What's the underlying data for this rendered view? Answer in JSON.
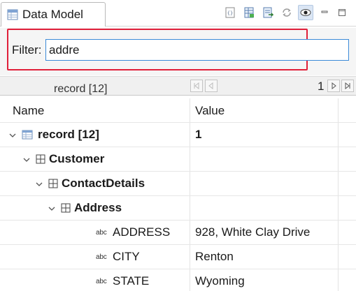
{
  "view": {
    "title": "Data Model",
    "toolbar": [
      "xml-view-icon",
      "table-view-icon",
      "export-icon",
      "refresh-icon",
      "show-icon",
      "minimize-icon",
      "maximize-icon"
    ]
  },
  "filter": {
    "label": "Filter:",
    "value": "addre"
  },
  "navigator": {
    "record_label": "record [12]",
    "current": "1"
  },
  "columns": {
    "name": "Name",
    "value": "Value"
  },
  "rows": [
    {
      "name": "record [12]",
      "value": "1",
      "icon": "table-icon",
      "expanded": true,
      "bold": true
    },
    {
      "name": "Customer",
      "value": "",
      "icon": "grid-icon",
      "expanded": true,
      "bold": true
    },
    {
      "name": "ContactDetails",
      "value": "",
      "icon": "grid-icon",
      "expanded": true,
      "bold": true
    },
    {
      "name": "Address",
      "value": "",
      "icon": "grid-icon",
      "expanded": true,
      "bold": true
    },
    {
      "name": "ADDRESS",
      "value": "928, White Clay Drive",
      "icon": "abc",
      "bold": false
    },
    {
      "name": "CITY",
      "value": "Renton",
      "icon": "abc",
      "bold": false
    },
    {
      "name": "STATE",
      "value": "Wyoming",
      "icon": "abc",
      "bold": false
    }
  ],
  "colors": {
    "accent": "#3b8ad8",
    "highlight": "#e0203a"
  }
}
